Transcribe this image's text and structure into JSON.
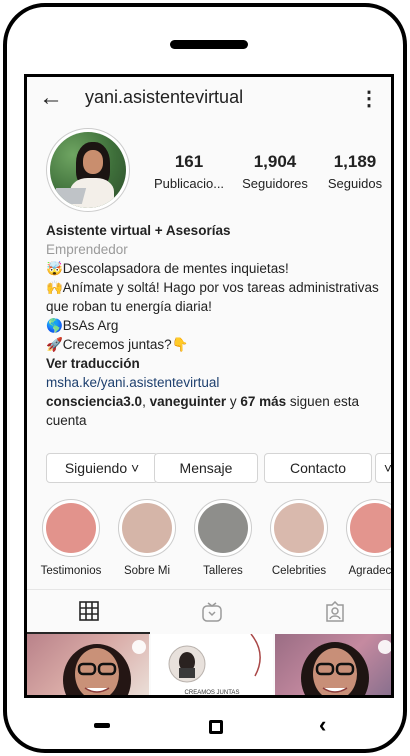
{
  "header": {
    "back_label": "←",
    "username": "yani.asistentevirtual",
    "more_label": "⋮"
  },
  "stats": [
    {
      "value": "161",
      "label": "Publicacio..."
    },
    {
      "value": "1,904",
      "label": "Seguidores"
    },
    {
      "value": "1,189",
      "label": "Seguidos"
    }
  ],
  "bio": {
    "name": "Asistente virtual + Asesorías",
    "category": "Emprendedor",
    "lines": [
      "🤯Descolapsadora de mentes inquietas!",
      "🙌Anímate y soltá! Hago por vos tareas administrativas que roban tu energía diaria!",
      "🌎BsAs Arg",
      "🚀Crecemos juntas?👇"
    ],
    "translate": "Ver traducción",
    "link": "msha.ke/yani.asistentevirtual",
    "followed_by_names": "consciencia3.0",
    "followed_by_sep": ", ",
    "followed_by_name2": "vaneguinter",
    "followed_by_and": " y ",
    "followed_by_more": "67 más",
    "followed_by_tail": " siguen esta cuenta"
  },
  "buttons": {
    "following": "Siguiendo ˅",
    "message": "Mensaje",
    "contact": "Contacto",
    "suggest": "˅"
  },
  "highlights": [
    {
      "label": "Testimonios",
      "color": "#e2938c"
    },
    {
      "label": "Sobre Mi",
      "color": "#d5b5a8"
    },
    {
      "label": "Talleres",
      "color": "#8e8e8b"
    },
    {
      "label": "Celebrities",
      "color": "#d9b9ad"
    },
    {
      "label": "Agradecer",
      "color": "#e3958e"
    }
  ],
  "tabs": {
    "grid_icon": "grid-icon",
    "igtv_icon": "igtv-icon",
    "tagged_icon": "tagged-icon"
  },
  "posts": [
    {
      "caption": ""
    },
    {
      "caption": "CREAMOS JUNTAS"
    },
    {
      "caption": ""
    }
  ],
  "colors": {
    "text": "#222222",
    "muted": "#9a9a9a",
    "link": "#1d3f6e"
  }
}
